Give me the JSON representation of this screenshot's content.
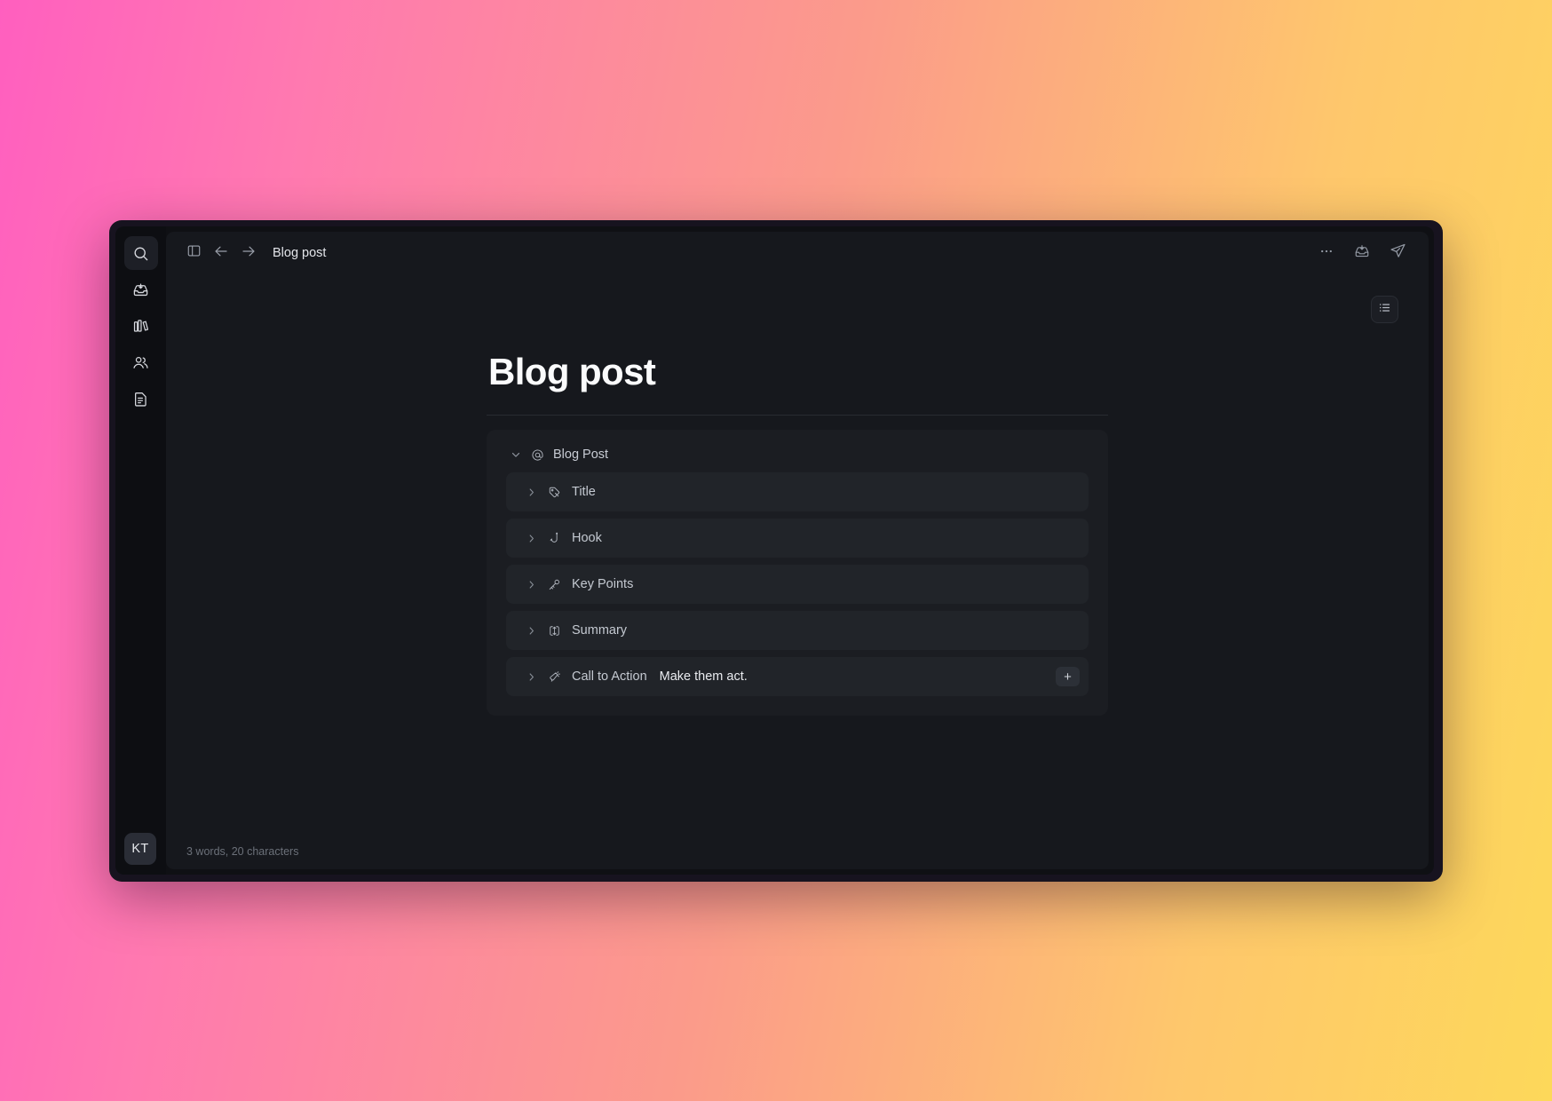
{
  "window": {
    "frame_bg": "#17131f",
    "app_bg": "#0f1014"
  },
  "background": {
    "gradient_from": "#FF5FBF",
    "gradient_mid": "#FB9B8A",
    "gradient_to": "#FDD85A"
  },
  "left_rail": {
    "items": [
      {
        "icon": "search-icon",
        "label": "Search",
        "active": true
      },
      {
        "icon": "inbox-icon",
        "label": "Inbox",
        "active": false
      },
      {
        "icon": "library-icon",
        "label": "Library",
        "active": false
      },
      {
        "icon": "people-icon",
        "label": "People",
        "active": false
      },
      {
        "icon": "document-icon",
        "label": "Documents",
        "active": false
      }
    ],
    "avatar_initials": "KT"
  },
  "topbar": {
    "sidebar_toggle_icon": "panel-left-icon",
    "back_icon": "arrow-left-icon",
    "forward_icon": "arrow-right-icon",
    "breadcrumb": "Blog post",
    "more_icon": "ellipsis-icon",
    "inbox_icon": "inbox-arrow-icon",
    "send_icon": "send-icon"
  },
  "outline_toggle": {
    "icon": "list-outline-icon",
    "label": "Outline"
  },
  "document": {
    "title": "Blog post",
    "group": {
      "icon": "at-icon",
      "chevron": "chevron-down-icon",
      "label": "Blog Post"
    },
    "blocks": [
      {
        "chevron": "chevron-right-icon",
        "icon": "pen-nib-icon",
        "label": "Title",
        "value": "",
        "has_add": false
      },
      {
        "chevron": "chevron-right-icon",
        "icon": "hook-icon",
        "label": "Hook",
        "value": "",
        "has_add": false
      },
      {
        "chevron": "chevron-right-icon",
        "icon": "key-icon",
        "label": "Key Points",
        "value": "",
        "has_add": false
      },
      {
        "chevron": "chevron-right-icon",
        "icon": "shuffle-icon",
        "label": "Summary",
        "value": "",
        "has_add": false
      },
      {
        "chevron": "chevron-right-icon",
        "icon": "megaphone-icon",
        "label": "Call to Action",
        "value": "Make them act.",
        "has_add": true,
        "add_label": "+"
      }
    ]
  },
  "statusbar": {
    "word_count": "3 words, 20 characters"
  }
}
